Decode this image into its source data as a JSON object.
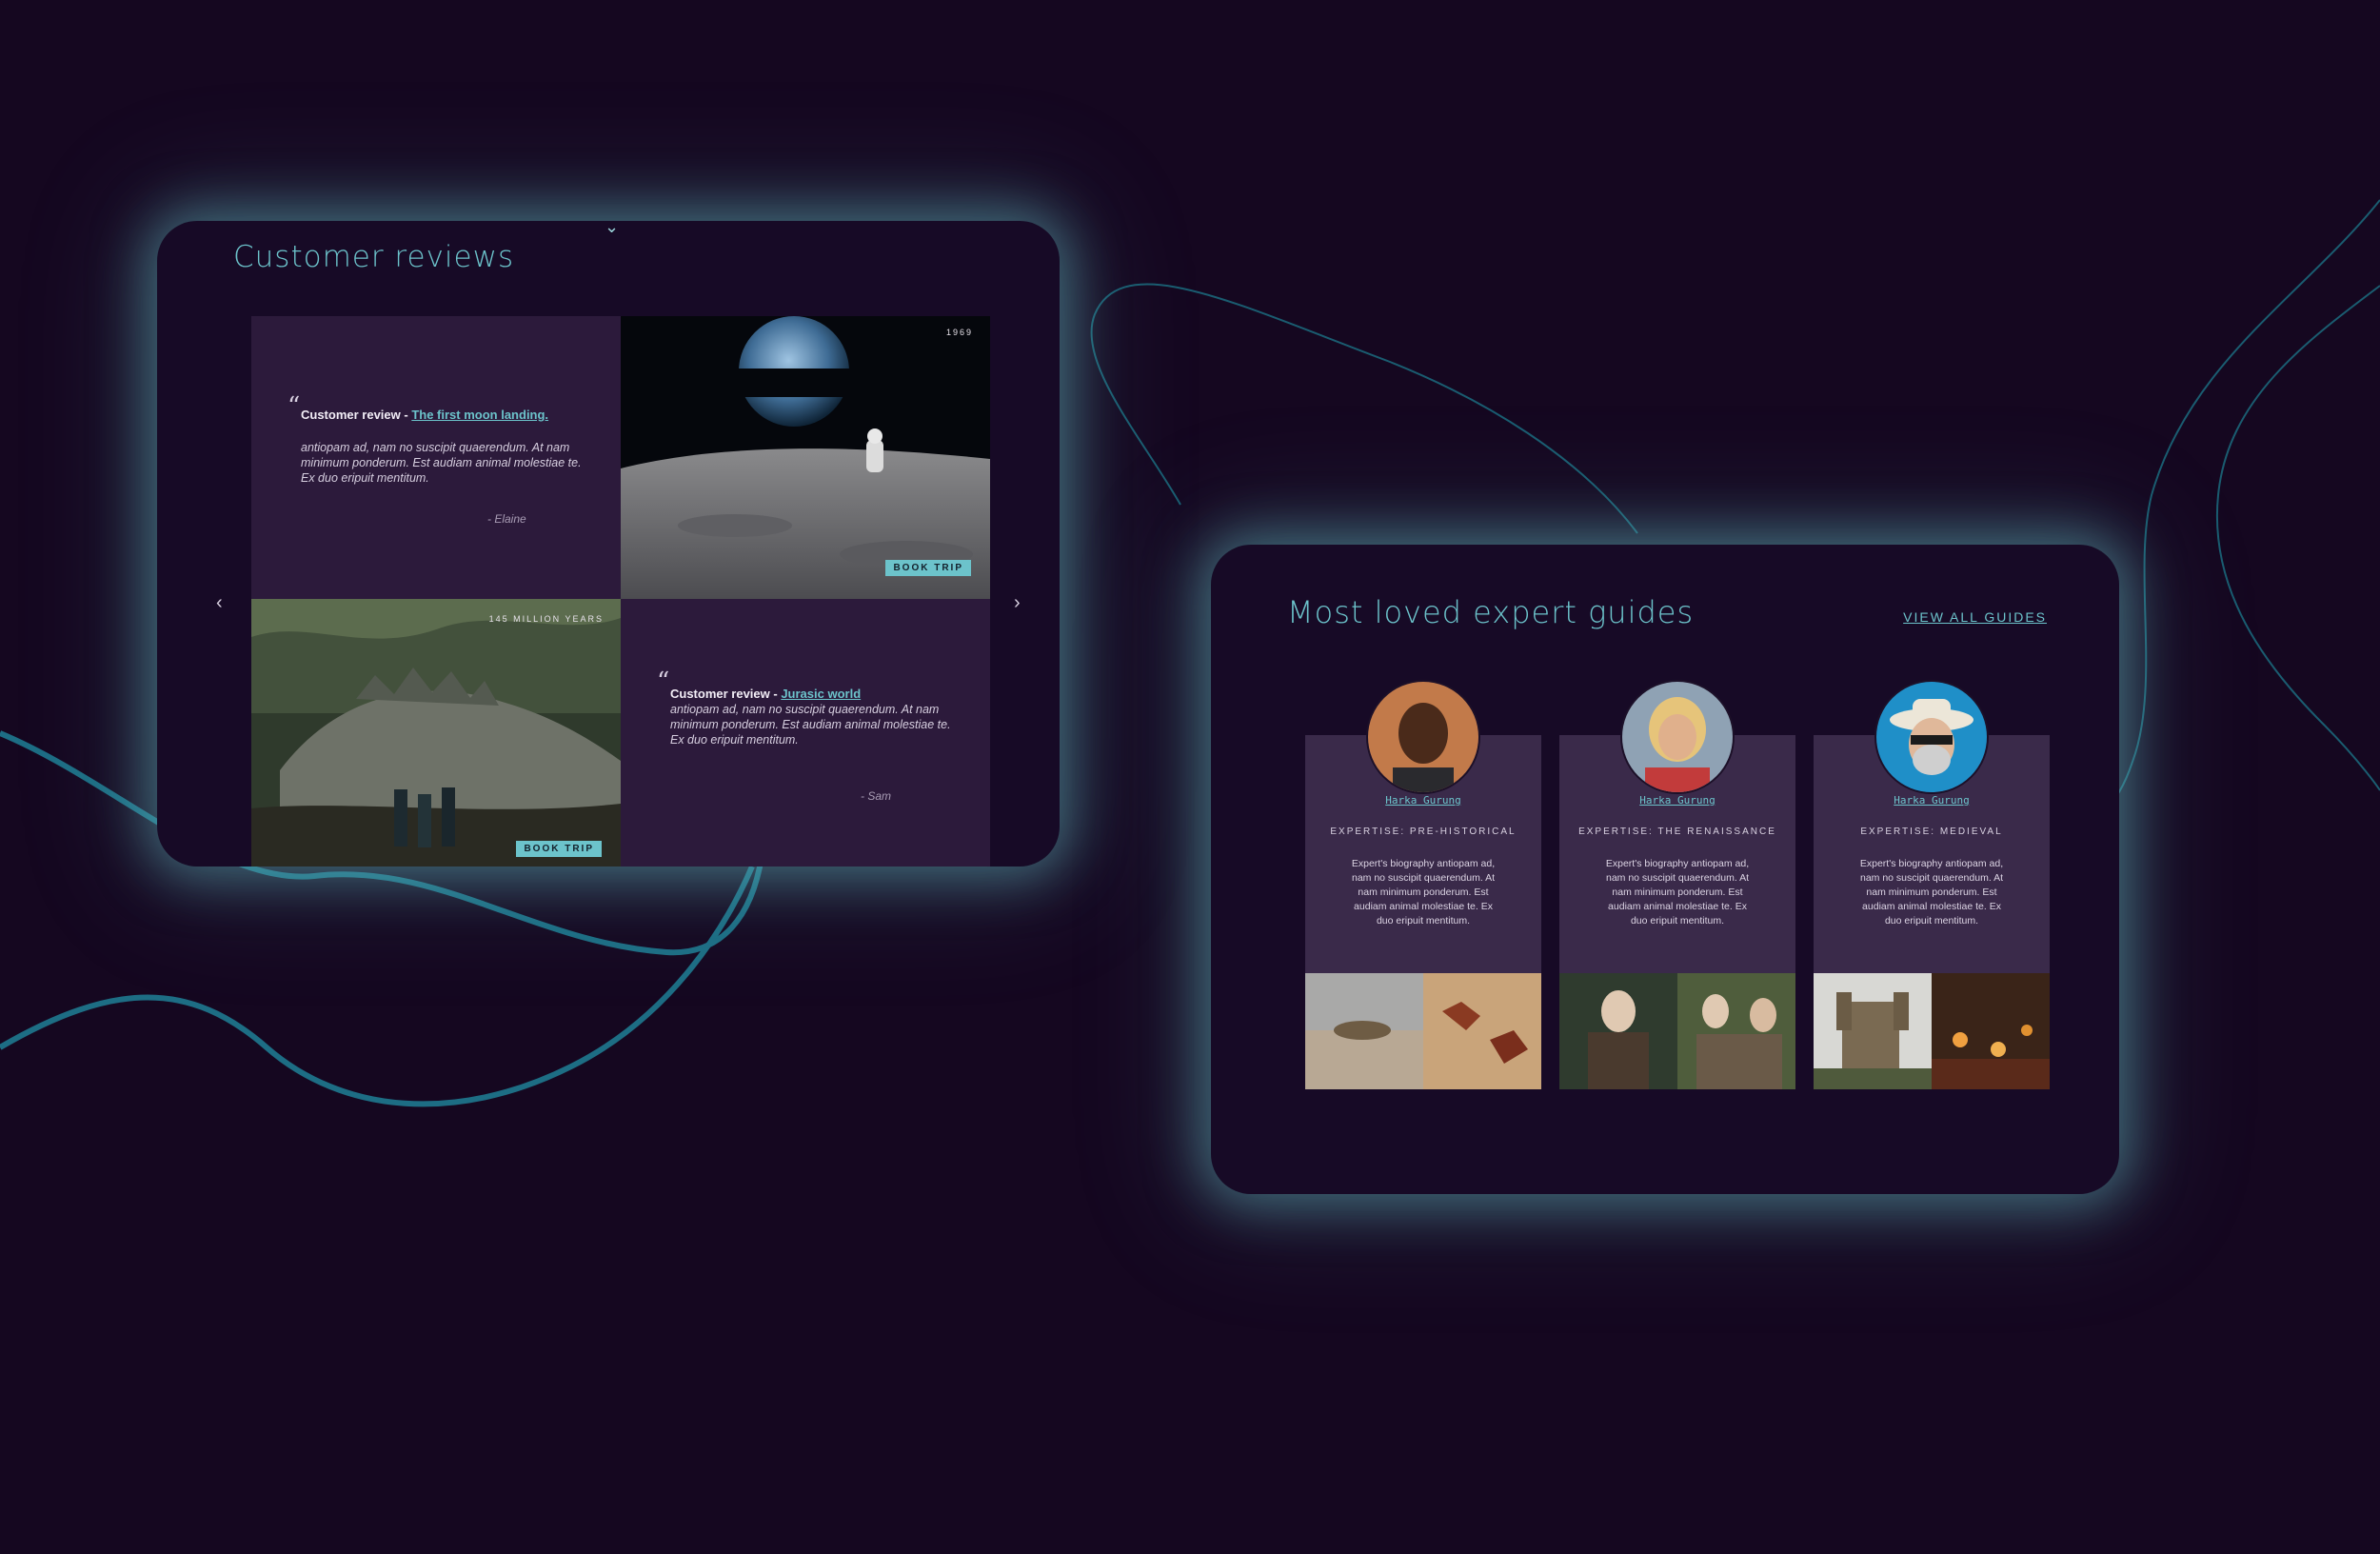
{
  "reviews": {
    "title": "Customer reviews",
    "items": [
      {
        "label": "Customer review - ",
        "link": "The first moon landing.",
        "body": "antiopam ad, nam no suscipit quaerendum. At nam minimum ponderum. Est audiam animal molestiae te. Ex duo eripuit mentitum.",
        "author": "- Elaine",
        "photo_label": "1969",
        "button": "BOOK TRIP"
      },
      {
        "label": "Customer review - ",
        "link": "Jurasic world",
        "body": "antiopam ad, nam no suscipit quaerendum. At nam minimum ponderum. Est audiam animal molestiae te. Ex duo eripuit mentitum.",
        "author": "- Sam",
        "photo_label": "145 MILLION YEARS",
        "button": "BOOK TRIP"
      }
    ],
    "prev_icon": "chevron-left-icon",
    "next_icon": "chevron-right-icon"
  },
  "guides": {
    "title": "Most loved expert guides",
    "view_all": "VIEW ALL GUIDES",
    "cards": [
      {
        "name": "Harka Gurung",
        "expertise": "EXPERTISE: PRE-HISTORICAL",
        "bio": "Expert's biography antiopam ad, nam no suscipit quaerendum. At nam minimum ponderum. Est audiam animal molestiae te. Ex duo eripuit mentitum."
      },
      {
        "name": "Harka Gurung",
        "expertise": "EXPERTISE: THE RENAISSANCE",
        "bio": "Expert's biography antiopam ad, nam no suscipit quaerendum. At nam minimum ponderum. Est audiam animal molestiae te. Ex duo eripuit mentitum."
      },
      {
        "name": "Harka Gurung",
        "expertise": "EXPERTISE: MEDIEVAL",
        "bio": "Expert's biography antiopam ad, nam no suscipit quaerendum. At nam minimum ponderum. Est audiam animal molestiae te. Ex duo eripuit mentitum."
      }
    ]
  },
  "colors": {
    "background": "#150720",
    "panel": "#170a26",
    "card": "#3a2a4a",
    "accent": "#6cc3cb",
    "glow": "#5caab2"
  }
}
